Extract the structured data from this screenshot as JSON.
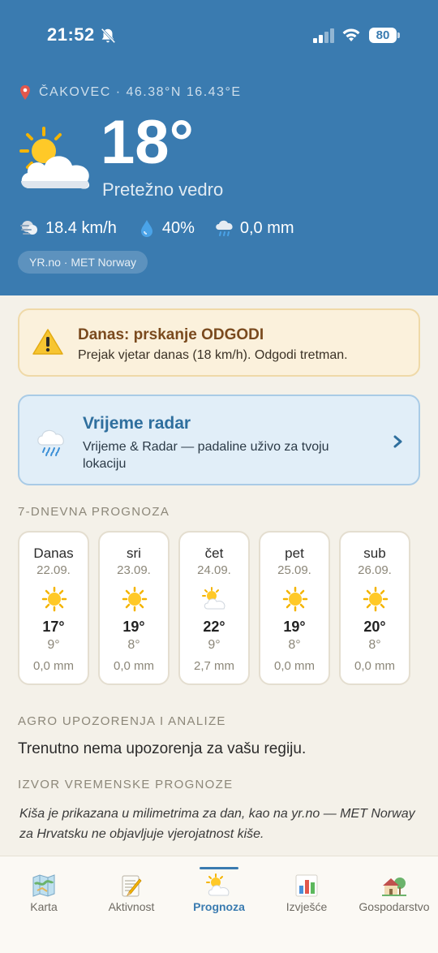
{
  "status_bar": {
    "time": "21:52",
    "battery": "80",
    "icons": [
      "bell-off-icon",
      "signal-icon",
      "wifi-icon",
      "battery-icon"
    ]
  },
  "current": {
    "location": "ČAKOVEC · 46.38°N 16.43°E",
    "temperature": "18°",
    "condition": "Pretežno vedro",
    "icon": "sun-behind-cloud-icon",
    "wind": "18.4 km/h",
    "humidity": "40%",
    "precipitation": "0,0 mm",
    "source": "YR.no · MET Norway"
  },
  "alert": {
    "title": "Danas: prskanje ODGODI",
    "text": "Prejak vjetar danas (18 km/h). Odgodi tretman.",
    "icon": "warning-icon"
  },
  "radar": {
    "title": "Vrijeme radar",
    "text": "Vrijeme & Radar — padaline uživo za tvoju lokaciju",
    "icon": "rain-cloud-icon"
  },
  "forecast": {
    "label": "7-DNEVNA PROGNOZA",
    "days": [
      {
        "name": "Danas",
        "date": "22.09.",
        "icon": "sun-icon",
        "max": "17°",
        "min": "9°",
        "rain": "0,0 mm"
      },
      {
        "name": "sri",
        "date": "23.09.",
        "icon": "sun-icon",
        "max": "19°",
        "min": "8°",
        "rain": "0,0 mm"
      },
      {
        "name": "čet",
        "date": "24.09.",
        "icon": "sun-behind-cloud-icon",
        "max": "22°",
        "min": "9°",
        "rain": "2,7 mm"
      },
      {
        "name": "pet",
        "date": "25.09.",
        "icon": "sun-icon",
        "max": "19°",
        "min": "8°",
        "rain": "0,0 mm"
      },
      {
        "name": "sub",
        "date": "26.09.",
        "icon": "sun-icon",
        "max": "20°",
        "min": "8°",
        "rain": "0,0 mm"
      }
    ]
  },
  "agro": {
    "label": "AGRO UPOZORENJA I ANALIZE",
    "text": "Trenutno nema upozorenja za vašu regiju."
  },
  "source_section": {
    "label": "IZVOR VREMENSKE PROGNOZE",
    "text": "Kiša je prikazana u milimetrima za dan, kao na yr.no — MET Norway za Hrvatsku ne objavljuje vjerojatnost kiše."
  },
  "tabs": [
    {
      "label": "Karta",
      "icon": "map-icon",
      "active": false
    },
    {
      "label": "Aktivnost",
      "icon": "notepad-icon",
      "active": false
    },
    {
      "label": "Prognoza",
      "icon": "weather-icon",
      "active": true
    },
    {
      "label": "Izvješće",
      "icon": "bar-chart-icon",
      "active": false
    },
    {
      "label": "Gospodarstvo",
      "icon": "farmhouse-icon",
      "active": false
    }
  ],
  "colors": {
    "header": "#3a7bb0",
    "background": "#f4f1e9",
    "alert_bg": "#fbf1dc",
    "alert_title": "#7a4a1e",
    "radar_bg": "#e1eef8",
    "radar_title": "#2f6f9e",
    "active_tab": "#3a7bb0"
  }
}
